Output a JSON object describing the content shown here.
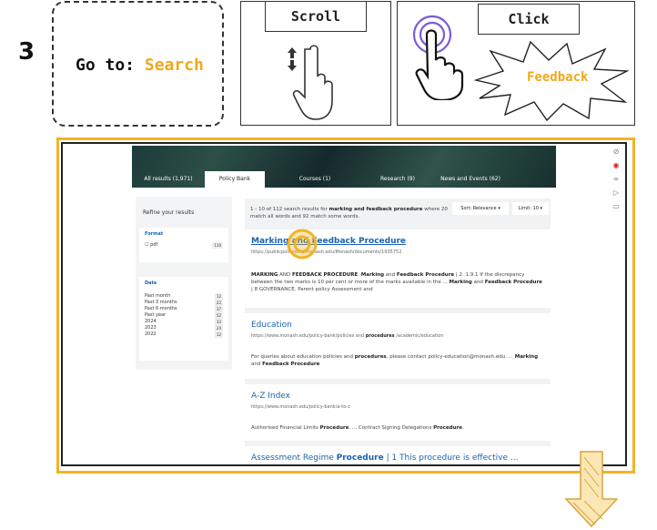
{
  "step": {
    "number": "3",
    "goto_prefix": "Go to:",
    "goto_target": "Search",
    "scroll_label": "Scroll",
    "click_label": "Click",
    "click_target": "Feedback"
  },
  "colors": {
    "highlight": "#f0b428",
    "link": "#1a63b0",
    "recording": "#d32020"
  },
  "icons": {
    "scroll_hand": "hand-scroll-icon",
    "click_hand": "hand-pointer-icon",
    "burst": "starburst-icon",
    "down_arrow": "down-arrow-icon",
    "click_target": "click-ring-icon"
  },
  "page": {
    "tabs": [
      {
        "label": "All results (1,971)",
        "active": false
      },
      {
        "label": "Policy Bank",
        "active": true
      },
      {
        "label": "Courses (1)",
        "active": false
      },
      {
        "label": "Research (9)",
        "active": false
      },
      {
        "label": "News and Events (62)",
        "active": false
      }
    ],
    "side_tools": [
      "⊘",
      "◉",
      "∞",
      "▷",
      "▭"
    ],
    "refine": {
      "title": "Refine your results",
      "format_head": "Format",
      "format_items": [
        {
          "label": "☐ pdf",
          "count": "110"
        }
      ],
      "date_head": "Date",
      "date_items": [
        {
          "label": "Past month",
          "count": "12"
        },
        {
          "label": "Past 3 months",
          "count": "22"
        },
        {
          "label": "Past 6 months",
          "count": "37"
        },
        {
          "label": "Past year",
          "count": "52"
        },
        {
          "label": "2024",
          "count": "33"
        },
        {
          "label": "2023",
          "count": "24"
        },
        {
          "label": "2022",
          "count": "12"
        }
      ]
    },
    "summary_pre": "1 - 10 of 112 search results for",
    "summary_query": "marking and feedback procedure",
    "summary_post": "where 20 match all words and 92 match some words.",
    "sort_label": "Sort: Relevance ▾",
    "limit_label": "Limit: 10 ▾",
    "results": [
      {
        "title": "Marking and Feedback Procedure",
        "url": "https://publicpolicydms.monash.edu/Monash/documents/1935752",
        "snippet_parts": [
          {
            "t": "MARKING",
            "b": true
          },
          {
            "t": " AND ",
            "b": false
          },
          {
            "t": "FEEDBACK PROCEDURE",
            "b": true
          },
          {
            "t": ". ",
            "b": false
          },
          {
            "t": "Marking",
            "b": true
          },
          {
            "t": " and ",
            "b": false
          },
          {
            "t": "Feedback Procedure",
            "b": true
          },
          {
            "t": " | 2. 1.9.1 If the discrepancy between the two marks is 10 per cent or more of the marks available in the ... ",
            "b": false
          },
          {
            "t": "Marking",
            "b": true
          },
          {
            "t": " and ",
            "b": false
          },
          {
            "t": "Feedback Procedure",
            "b": true
          },
          {
            "t": " | 8 GOVERNANCE. Parent policy Assessment and",
            "b": false
          }
        ]
      },
      {
        "title": "Education",
        "url_pre": "https://www.monash.edu/policy-bank/policies and",
        "url_bold": "procedures",
        "url_post": "/academic/education",
        "snippet_parts": [
          {
            "t": "For queries about education policies and ",
            "b": false
          },
          {
            "t": "procedures",
            "b": true
          },
          {
            "t": ", please contact policy-education@monash.edu. ... ",
            "b": false
          },
          {
            "t": "Marking",
            "b": true
          },
          {
            "t": " and ",
            "b": false
          },
          {
            "t": "Feedback Procedure",
            "b": true
          }
        ]
      },
      {
        "title": "A-Z Index",
        "url": "https://www.monash.edu/policy-bank/a-to-z",
        "snippet_parts": [
          {
            "t": "Authorised Financial Limits ",
            "b": false
          },
          {
            "t": "Procedure",
            "b": true
          },
          {
            "t": ". ... Contract Signing Delegations ",
            "b": false
          },
          {
            "t": "Procedure",
            "b": true
          },
          {
            "t": ".",
            "b": false
          }
        ]
      },
      {
        "title_pre": "Assessment Regime",
        "title_bold": "Procedure",
        "title_post": "| 1 This procedure is effective ..."
      }
    ]
  }
}
